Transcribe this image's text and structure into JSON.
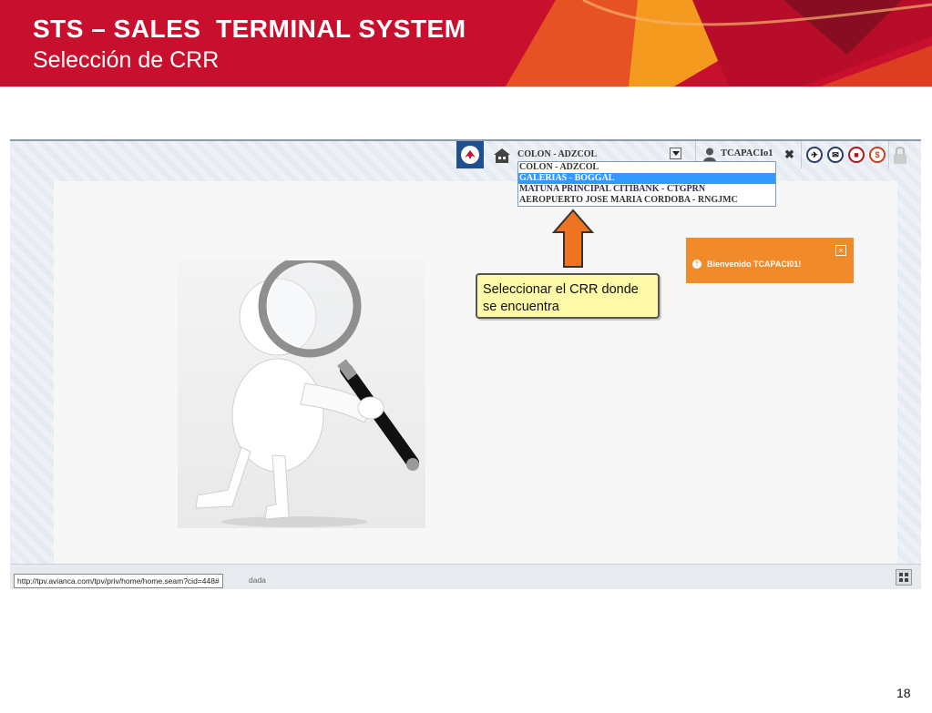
{
  "slide": {
    "title": "STS – SALES  TERMINAL SYSTEM",
    "subtitle": "Selección de CRR",
    "page_number": "18"
  },
  "toolbar": {
    "selected_crr": "COLON - ADZCOL",
    "user": "TCAPACIo1",
    "icons": [
      "airline-logo-icon",
      "home-icon",
      "user-icon",
      "close-icon",
      "ticket-icon",
      "mail-icon",
      "bag-icon",
      "dollar-icon",
      "lock-icon"
    ]
  },
  "crr_options": [
    {
      "label": "COLON - ADZCOL"
    },
    {
      "label": "GALERIAS - BOGGAL"
    },
    {
      "label": "MATUNA PRINCIPAL CITIBANK - CTGPRN"
    },
    {
      "label": "AEROPUERTO JOSE MARIA CORDOBA - RNGJMC"
    }
  ],
  "selected_option_index": 1,
  "toast": {
    "message": "Bienvenido TCAPACI01!",
    "close": "×"
  },
  "callout": {
    "text": "Seleccionar el CRR donde se encuentra"
  },
  "status_bar": {
    "url": "http://tpv.avianca.com/tpv/priv/home/home.seam?cid=448#",
    "tail": "dada"
  },
  "colors": {
    "banner": "#c8102e",
    "accent_orange": "#f08a2b",
    "selection_blue": "#3399ff"
  }
}
